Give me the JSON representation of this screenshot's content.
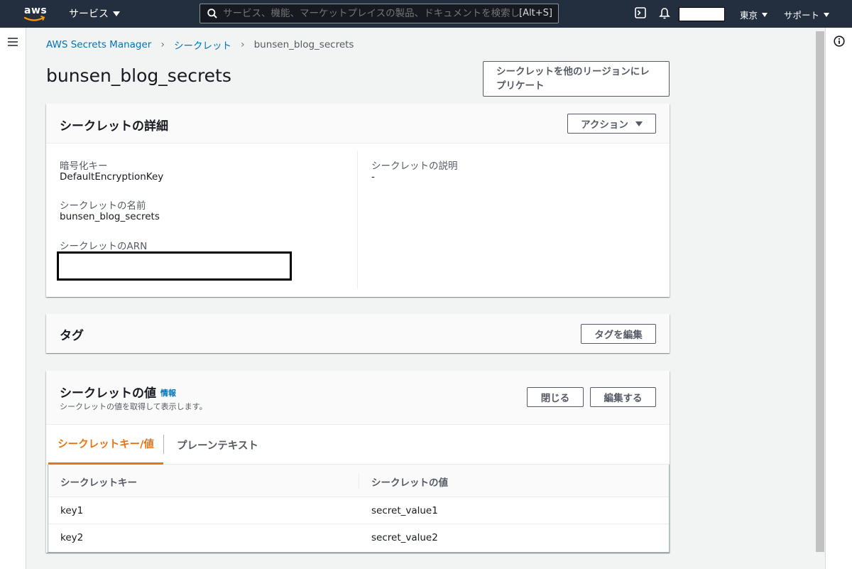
{
  "topnav": {
    "logo": "aws",
    "services": "サービス",
    "search_placeholder": "サービス、機能、マーケットプレイスの製品、ドキュメントを検索し",
    "search_shortcut": "[Alt+S]",
    "region": "東京",
    "support": "サポート"
  },
  "breadcrumb": [
    "AWS Secrets Manager",
    "シークレット",
    "bunsen_blog_secrets"
  ],
  "page": {
    "title": "bunsen_blog_secrets",
    "replicate_button": "シークレットを他のリージョンにレプリケート"
  },
  "details": {
    "title": "シークレットの詳細",
    "actions_button": "アクション",
    "encryption_key_label": "暗号化キー",
    "encryption_key_value": "DefaultEncryptionKey",
    "name_label": "シークレットの名前",
    "name_value": "bunsen_blog_secrets",
    "arn_label": "シークレットのARN",
    "description_label": "シークレットの説明",
    "description_value": "-"
  },
  "tags": {
    "title": "タグ",
    "edit_button": "タグを編集"
  },
  "secret_value": {
    "title": "シークレットの値",
    "info_link": "情報",
    "subtitle": "シークレットの値を取得して表示します。",
    "close_button": "閉じる",
    "edit_button": "編集する",
    "tabs": [
      "シークレットキー/値",
      "プレーンテキスト"
    ],
    "columns": [
      "シークレットキー",
      "シークレットの値"
    ],
    "rows": [
      {
        "key": "key1",
        "value": "secret_value1"
      },
      {
        "key": "key2",
        "value": "secret_value2"
      }
    ]
  },
  "colors": {
    "nav_bg": "#232f3e",
    "link": "#0073bb",
    "active_tab": "#ec7211"
  }
}
